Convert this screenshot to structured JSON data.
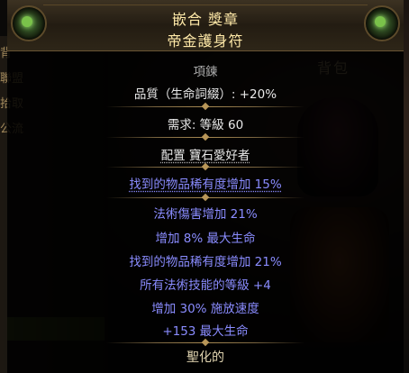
{
  "background": {
    "left_menu": [
      "背",
      "聯盟",
      "拾取",
      "公流"
    ],
    "inventory_title": "背包"
  },
  "tooltip": {
    "title_line1": "嵌合 獎章",
    "title_line2": "帝金護身符",
    "item_class": "項鍊",
    "quality": "品質（生命詞綴）: +20%",
    "requirement": "需求: 等級 60",
    "anointed": "配置 寶石愛好者",
    "implicit": "找到的物品稀有度增加 15%",
    "mods": [
      "法術傷害增加 21%",
      "增加 8% 最大生命",
      "找到的物品稀有度增加 21%",
      "所有法術技能的等級 +4",
      "增加 30% 施放速度",
      "+153 最大生命"
    ],
    "footer": "聖化的"
  },
  "colors": {
    "title": "#ffe9a8",
    "magic_mod": "#8a8cff",
    "text": "#e8e8e8"
  }
}
